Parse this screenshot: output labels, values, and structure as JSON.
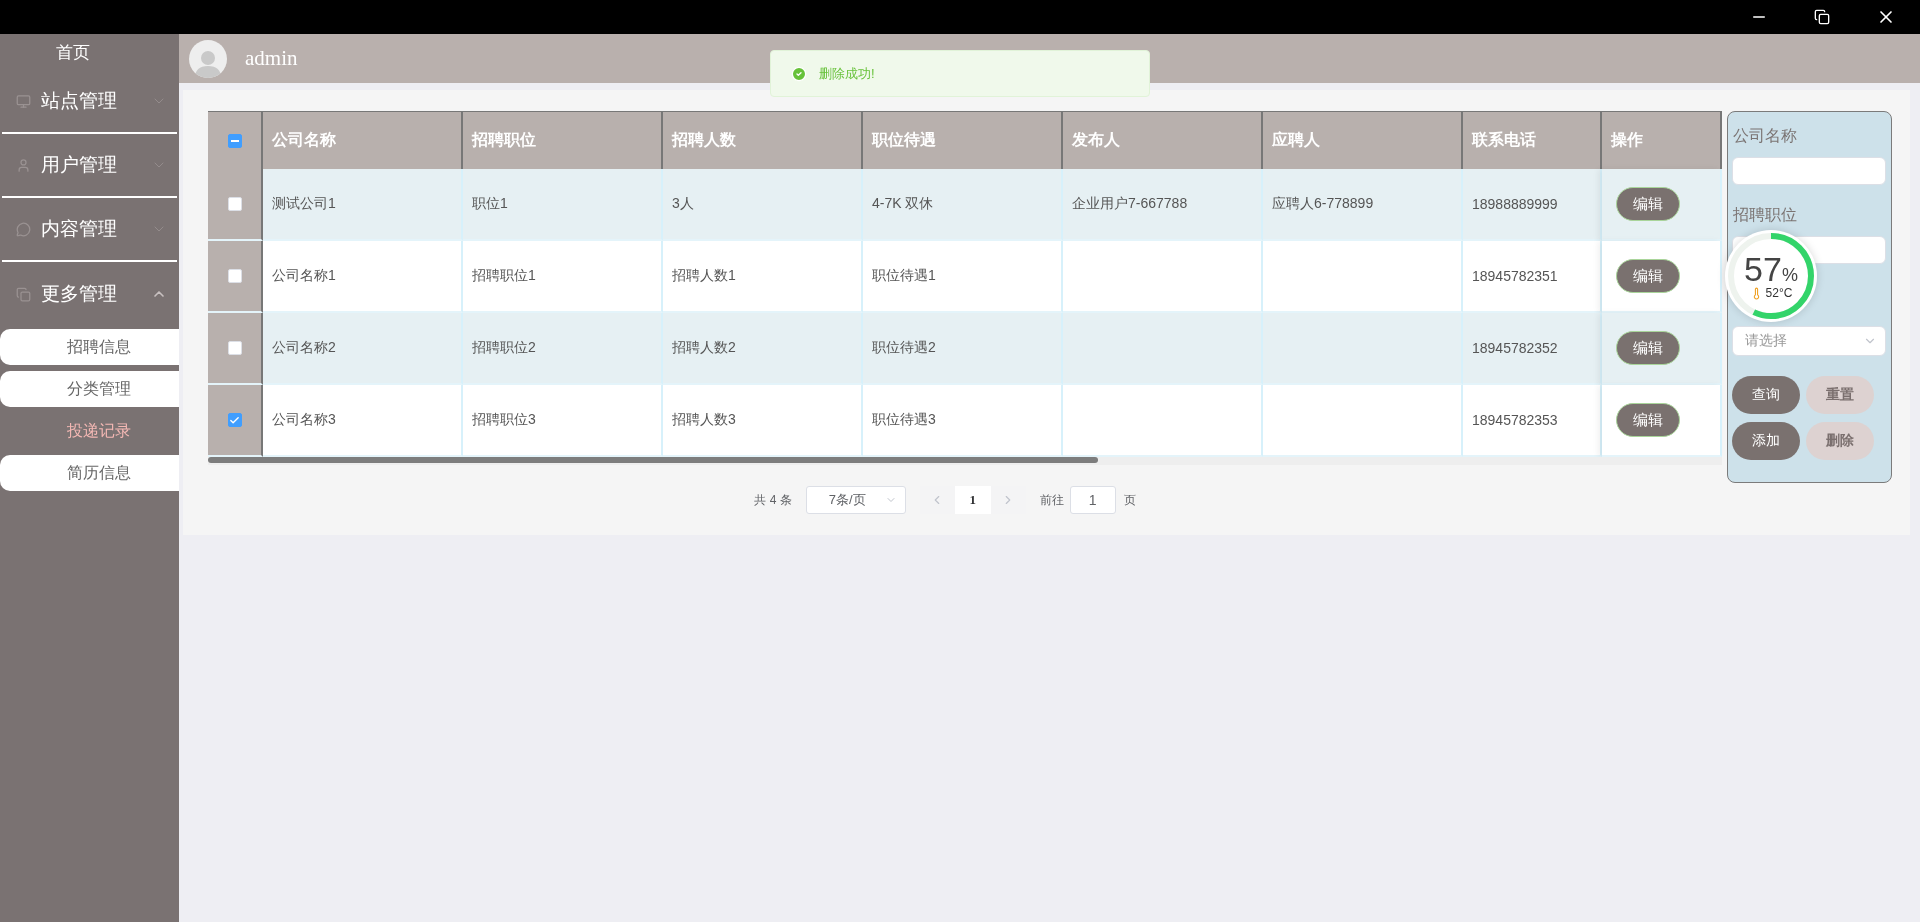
{
  "sidebar": {
    "home": "首页",
    "menus": [
      {
        "label": "站点管理",
        "expanded": false
      },
      {
        "label": "用户管理",
        "expanded": false
      },
      {
        "label": "内容管理",
        "expanded": false
      },
      {
        "label": "更多管理",
        "expanded": true,
        "children": [
          {
            "label": "招聘信息",
            "selected": false
          },
          {
            "label": "分类管理",
            "selected": false
          },
          {
            "label": "投递记录",
            "selected": true
          },
          {
            "label": "简历信息",
            "selected": false
          }
        ]
      }
    ]
  },
  "header": {
    "username": "admin"
  },
  "toast": {
    "message": "删除成功!"
  },
  "table": {
    "select_all": {
      "indeterminate": true
    },
    "columns": [
      "公司名称",
      "招聘职位",
      "招聘人数",
      "职位待遇",
      "发布人",
      "应聘人",
      "联系电话",
      "操作"
    ],
    "rows": [
      {
        "checked": false,
        "cells": [
          "测试公司1",
          "职位1",
          "3人",
          "4-7K 双休",
          "企业用户7-667788",
          "应聘人6-778899",
          "18988889999"
        ],
        "action": "编辑"
      },
      {
        "checked": false,
        "cells": [
          "公司名称1",
          "招聘职位1",
          "招聘人数1",
          "职位待遇1",
          "",
          "",
          "18945782351"
        ],
        "action": "编辑"
      },
      {
        "checked": false,
        "cells": [
          "公司名称2",
          "招聘职位2",
          "招聘人数2",
          "职位待遇2",
          "",
          "",
          "18945782352"
        ],
        "action": "编辑"
      },
      {
        "checked": true,
        "cells": [
          "公司名称3",
          "招聘职位3",
          "招聘人数3",
          "职位待遇3",
          "",
          "",
          "18945782353"
        ],
        "action": "编辑"
      }
    ]
  },
  "pagination": {
    "total": "共 4 条",
    "page_size": "7条/页",
    "current_page": "1",
    "goto_label": "前往",
    "goto_value": "1",
    "page_unit": "页"
  },
  "filter_panel": {
    "fields": [
      {
        "kind": "input",
        "label": "公司名称"
      },
      {
        "kind": "input",
        "label": "招聘职位"
      },
      {
        "kind": "select",
        "placeholder": "请选择"
      }
    ],
    "buttons": [
      {
        "label": "查询",
        "primary": true
      },
      {
        "label": "重置",
        "primary": false
      },
      {
        "label": "添加",
        "primary": true
      },
      {
        "label": "删除",
        "primary": false
      }
    ]
  },
  "monitor_widget": {
    "percent": "57",
    "unit": "%",
    "temperature": "52°C",
    "level": 0.57
  }
}
